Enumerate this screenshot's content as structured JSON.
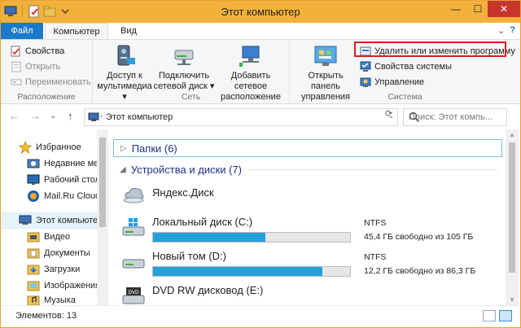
{
  "window": {
    "title": "Этот компьютер"
  },
  "titlebar": {
    "minimize": "—",
    "maximize": "☐",
    "close": "✕"
  },
  "tabs": [
    {
      "label": "Файл"
    },
    {
      "label": "Компьютер"
    },
    {
      "label": "Вид"
    }
  ],
  "tabs_right": {
    "collapse": "⌄",
    "help": "?"
  },
  "ribbon": {
    "location": {
      "label": "Расположение",
      "properties": "Свойства",
      "open": "Открыть",
      "rename": "Переименовать"
    },
    "network": {
      "label": "Сеть",
      "media_access": [
        "Доступ к",
        "мультимедиа ▾"
      ],
      "map_drive": [
        "Подключить",
        "сетевой диск ▾"
      ],
      "add_location": [
        "Добавить сетевое",
        "расположение"
      ]
    },
    "system": {
      "label": "Система",
      "control_panel": [
        "Открыть панель",
        "управления"
      ],
      "uninstall": "Удалить или изменить программу",
      "system_props": "Свойства системы",
      "manage": "Управление"
    }
  },
  "address": {
    "back": "←",
    "forward": "→",
    "recent": "⌄",
    "up": "↑",
    "path": "Этот компьютер",
    "dropdown": "⌄",
    "refresh": "⟳",
    "search_placeholder": "Поиск: Этот компь..."
  },
  "nav": {
    "items": [
      {
        "label": "Избранное",
        "icon": "star-icon"
      },
      {
        "label": "Недавние мес",
        "icon": "recent-places-icon"
      },
      {
        "label": "Рабочий стол",
        "icon": "desktop-icon"
      },
      {
        "label": "Mail.Ru Cloud",
        "icon": "mailru-cloud-icon"
      },
      {
        "label": "Этот компьютер",
        "icon": "computer-icon"
      },
      {
        "label": "Видео",
        "icon": "video-folder-icon"
      },
      {
        "label": "Документы",
        "icon": "documents-folder-icon"
      },
      {
        "label": "Загрузки",
        "icon": "downloads-folder-icon"
      },
      {
        "label": "Изображения",
        "icon": "pictures-folder-icon"
      },
      {
        "label": "Музыка",
        "icon": "music-folder-icon"
      }
    ]
  },
  "content": {
    "folders_group": "Папки (6)",
    "devices_group": "Устройства и диски (7)",
    "drives": [
      {
        "name": "Яндекс.Диск",
        "icon": "yandex-disk-icon"
      },
      {
        "name": "Локальный диск (C:)",
        "fs": "NTFS",
        "free": "45,4 ГБ свободно из 105 ГБ",
        "used_fraction": 0.57,
        "icon": "windows-drive-icon"
      },
      {
        "name": "Новый том (D:)",
        "fs": "NTFS",
        "free": "12,2 ГБ свободно из 86,3 ГБ",
        "used_fraction": 0.86,
        "icon": "hard-drive-icon"
      },
      {
        "name": "DVD RW дисковод (E:)",
        "icon": "dvd-drive-icon"
      }
    ]
  },
  "status": {
    "count": "Элементов: 13"
  },
  "colors": {
    "titlebar": "#f2b13a",
    "file_tab": "#1979ca",
    "accent_bar": "#26a0da",
    "highlight": "#d42020"
  }
}
